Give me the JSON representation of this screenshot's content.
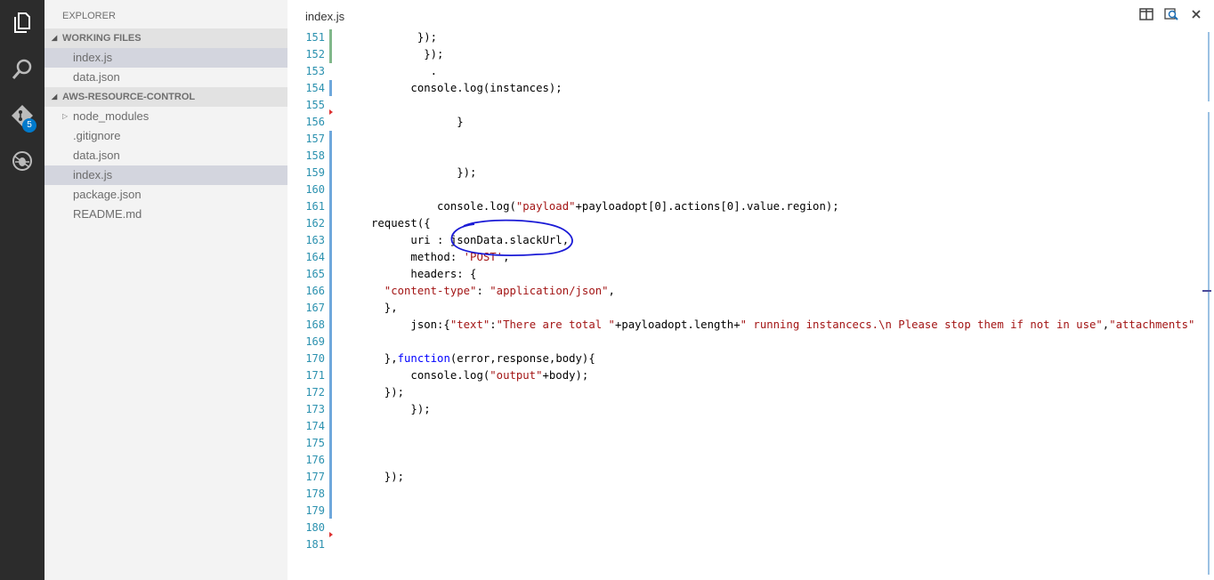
{
  "sidebar": {
    "title": "EXPLORER",
    "working_files": {
      "header": "WORKING FILES",
      "items": [
        {
          "label": "index.js",
          "selected": true
        },
        {
          "label": "data.json",
          "selected": false
        }
      ]
    },
    "project": {
      "header": "AWS-RESOURCE-CONTROL",
      "items": [
        {
          "label": "node_modules",
          "folder": true
        },
        {
          "label": ".gitignore"
        },
        {
          "label": "data.json"
        },
        {
          "label": "index.js",
          "selected": true
        },
        {
          "label": "package.json"
        },
        {
          "label": "README.md"
        }
      ]
    }
  },
  "activity": {
    "icons": [
      "files-icon",
      "search-icon",
      "git-icon",
      "debug-icon"
    ],
    "git_badge": "5"
  },
  "editor": {
    "tab_title": "index.js",
    "toolbar": [
      "split-editor-icon",
      "open-changes-icon",
      "close-icon"
    ],
    "lines": [
      {
        "n": "151",
        "code": [
          [
            "t",
            "       });"
          ]
        ]
      },
      {
        "n": "152",
        "code": [
          [
            "t",
            "        });"
          ]
        ]
      },
      {
        "n": "153",
        "code": [
          [
            "t",
            "         ."
          ]
        ]
      },
      {
        "n": "154",
        "code": [
          [
            "t",
            "      console.log(instances);"
          ]
        ]
      },
      {
        "n": "155",
        "code": [
          [
            "t",
            ""
          ]
        ]
      },
      {
        "n": "156",
        "code": [
          [
            "t",
            "             }"
          ]
        ]
      },
      {
        "n": "157",
        "code": [
          [
            "t",
            ""
          ]
        ]
      },
      {
        "n": "158",
        "code": [
          [
            "t",
            ""
          ]
        ]
      },
      {
        "n": "159",
        "code": [
          [
            "t",
            "             });"
          ]
        ]
      },
      {
        "n": "160",
        "code": [
          [
            "t",
            ""
          ]
        ]
      },
      {
        "n": "161",
        "code": [
          [
            "t",
            "          console.log("
          ],
          [
            "s",
            "\"payload\""
          ],
          [
            "t",
            "+payloadopt[0].actions[0].value.region);"
          ]
        ]
      },
      {
        "n": "162",
        "code": [
          [
            "t",
            "request({"
          ]
        ]
      },
      {
        "n": "163",
        "code": [
          [
            "t",
            "      uri : jsonData.slackUrl,"
          ]
        ]
      },
      {
        "n": "164",
        "code": [
          [
            "t",
            "      method: "
          ],
          [
            "s",
            "'POST'"
          ],
          [
            "t",
            ","
          ]
        ]
      },
      {
        "n": "165",
        "code": [
          [
            "t",
            "      headers: {"
          ]
        ]
      },
      {
        "n": "166",
        "code": [
          [
            "s",
            "  \"content-type\""
          ],
          [
            "t",
            ": "
          ],
          [
            "s",
            "\"application/json\""
          ],
          [
            "t",
            ","
          ]
        ]
      },
      {
        "n": "167",
        "code": [
          [
            "t",
            "  },"
          ]
        ]
      },
      {
        "n": "168",
        "code": [
          [
            "t",
            "      json:{"
          ],
          [
            "s",
            "\"text\""
          ],
          [
            "t",
            ":"
          ],
          [
            "s",
            "\"There are total \""
          ],
          [
            "t",
            "+payloadopt.length+"
          ],
          [
            "s",
            "\" running instancecs.\\n Please stop them if not in use\""
          ],
          [
            "t",
            ","
          ],
          [
            "s",
            "\"attachments\""
          ]
        ]
      },
      {
        "n": "169",
        "code": [
          [
            "t",
            ""
          ]
        ]
      },
      {
        "n": "170",
        "code": [
          [
            "t",
            "  },"
          ],
          [
            "k",
            "function"
          ],
          [
            "t",
            "(error,response,body){"
          ]
        ]
      },
      {
        "n": "171",
        "code": [
          [
            "t",
            "      console.log("
          ],
          [
            "s",
            "\"output\""
          ],
          [
            "t",
            "+body);"
          ]
        ]
      },
      {
        "n": "172",
        "code": [
          [
            "t",
            "  });"
          ]
        ]
      },
      {
        "n": "173",
        "code": [
          [
            "t",
            "      });"
          ]
        ]
      },
      {
        "n": "174",
        "code": [
          [
            "t",
            ""
          ]
        ]
      },
      {
        "n": "175",
        "code": [
          [
            "t",
            ""
          ]
        ]
      },
      {
        "n": "176",
        "code": [
          [
            "t",
            ""
          ]
        ]
      },
      {
        "n": "177",
        "code": [
          [
            "t",
            "  });"
          ]
        ]
      },
      {
        "n": "178",
        "code": [
          [
            "t",
            ""
          ]
        ]
      },
      {
        "n": "179",
        "code": [
          [
            "t",
            ""
          ]
        ]
      },
      {
        "n": "180",
        "code": [
          [
            "t",
            ""
          ]
        ]
      },
      {
        "n": "181",
        "code": [
          [
            "t",
            ""
          ]
        ]
      }
    ]
  },
  "colors": {
    "activity_bg": "#2c2c2c",
    "sidebar_bg": "#f3f3f3",
    "line_number": "#2b91af",
    "string": "#a31515",
    "keyword": "#0000ff",
    "annotation": "#1a1ad6"
  }
}
